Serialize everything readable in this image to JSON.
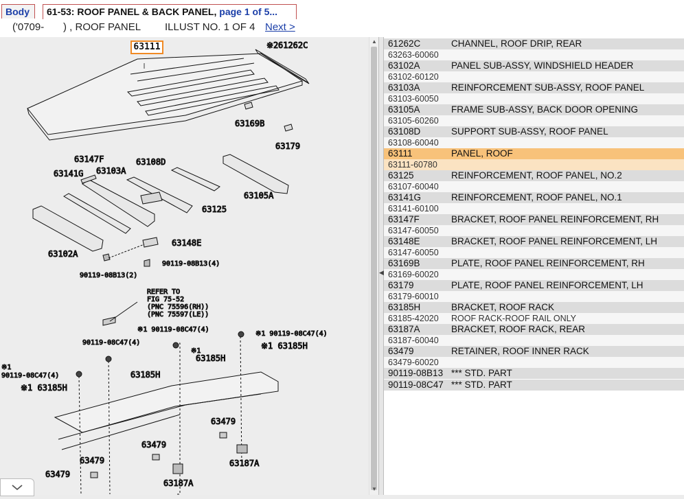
{
  "tabs": {
    "body_label": "Body",
    "active_title": "61-53: ROOF PANEL & BACK PANEL,",
    "active_page": " page 1 of 5..."
  },
  "subheader": {
    "range": "('0709-",
    "range_end": ") , ROOF PANEL",
    "illust": "ILLUST NO. 1 OF 4",
    "next_label": "Next >"
  },
  "illustration": {
    "highlight_callout": "63111",
    "labels": {
      "p61262c": "61262C",
      "p61262c_note": "※2",
      "p63169b": "63169B",
      "p63179": "63179",
      "p63147f": "63147F",
      "p63108d": "63108D",
      "p63141g": "63141G",
      "p63103a": "63103A",
      "p63105a": "63105A",
      "p63125": "63125",
      "p63148e": "63148E",
      "p63102a": "63102A",
      "p90119_08b13_4": "90119-08B13(4)",
      "p90119_08b13_2": "90119-08B13(2)",
      "refer1": "REFER TO",
      "refer2": "FIG 75-52",
      "refer3": "(PNC 75596(RH))",
      "refer4": "(PNC 75597(LE))",
      "p90119_08c47_a": "※1 90119-08C47(4)",
      "p90119_08c47_b": "※1 90119-08C47(4)",
      "p90119_08c47_c": "90119-08C47(4)",
      "p63185h_a": "※1 63185H",
      "p63185h_b": "※1",
      "p63185h_b2": "63185H",
      "p63185h_c": "63185H",
      "p90119_08c47_d_note": "※1",
      "p90119_08c47_d": "90119-08C47(4)",
      "p63185h_d": "※1 63185H",
      "p63479_a": "63479",
      "p63479_b": "63479",
      "p63479_c": "63479",
      "p63479_d": "63479",
      "p63187a_a": "63187A",
      "p63187a_b": "63187A"
    }
  },
  "parts": [
    {
      "code": "61262C",
      "desc": "CHANNEL, ROOF DRIP, REAR",
      "pn": "63263-60060",
      "pn_desc": ""
    },
    {
      "code": "63102A",
      "desc": "PANEL SUB-ASSY, WINDSHIELD HEADER",
      "pn": "63102-60120",
      "pn_desc": ""
    },
    {
      "code": "63103A",
      "desc": "REINFORCEMENT SUB-ASSY, ROOF PANEL",
      "pn": "63103-60050",
      "pn_desc": ""
    },
    {
      "code": "63105A",
      "desc": "FRAME SUB-ASSY, BACK DOOR OPENING",
      "pn": "63105-60260",
      "pn_desc": ""
    },
    {
      "code": "63108D",
      "desc": "SUPPORT SUB-ASSY, ROOF PANEL",
      "pn": "63108-60040",
      "pn_desc": ""
    },
    {
      "code": "63111",
      "desc": "PANEL, ROOF",
      "pn": "63111-60780",
      "pn_desc": ""
    },
    {
      "code": "63125",
      "desc": "REINFORCEMENT, ROOF PANEL, NO.2",
      "pn": "63107-60040",
      "pn_desc": ""
    },
    {
      "code": "63141G",
      "desc": "REINFORCEMENT, ROOF PANEL, NO.1",
      "pn": "63141-60100",
      "pn_desc": ""
    },
    {
      "code": "63147F",
      "desc": "BRACKET, ROOF PANEL REINFORCEMENT, RH",
      "pn": "63147-60050",
      "pn_desc": ""
    },
    {
      "code": "63148E",
      "desc": "BRACKET, ROOF PANEL REINFORCEMENT, LH",
      "pn": "63147-60050",
      "pn_desc": ""
    },
    {
      "code": "63169B",
      "desc": "PLATE, ROOF PANEL REINFORCEMENT, RH",
      "pn": "63169-60020",
      "pn_desc": ""
    },
    {
      "code": "63179",
      "desc": "PLATE, ROOF PANEL REINFORCEMENT, LH",
      "pn": "63179-60010",
      "pn_desc": ""
    },
    {
      "code": "63185H",
      "desc": "BRACKET, ROOF RACK",
      "pn": "63185-42020",
      "pn_desc": "ROOF RACK-ROOF RAIL ONLY"
    },
    {
      "code": "63187A",
      "desc": "BRACKET, ROOF RACK, REAR",
      "pn": "63187-60040",
      "pn_desc": ""
    },
    {
      "code": "63479",
      "desc": "RETAINER, ROOF INNER RACK",
      "pn": "63479-60020",
      "pn_desc": ""
    },
    {
      "code": "90119-08B13",
      "desc": "*** STD. PART",
      "pn": "",
      "pn_desc": ""
    },
    {
      "code": "90119-08C47",
      "desc": "*** STD. PART",
      "pn": "",
      "pn_desc": ""
    }
  ],
  "selected_code": "63111",
  "colors": {
    "highlight_row": "#f8c27a",
    "highlight_sub": "#fbe3c2",
    "callout_border": "#f08a24",
    "link": "#1a3ea8"
  },
  "icons": {
    "collapse": "chevron-down-icon",
    "splitter": "splitter-grip-icon"
  }
}
